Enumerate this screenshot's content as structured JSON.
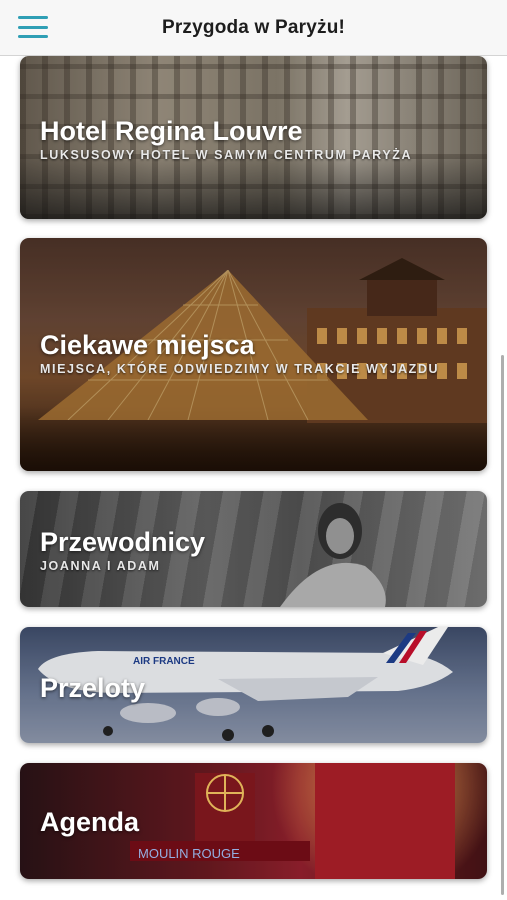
{
  "header": {
    "title": "Przygoda w Paryżu!",
    "menu_icon": "hamburger-menu-icon",
    "accent_color": "#2f9fb5"
  },
  "cards": [
    {
      "title": "Hotel Regina Louvre",
      "subtitle": "LUKSUSOWY HOTEL W SAMYM CENTRUM PARYŻA",
      "image": "hotel-facade-image"
    },
    {
      "title": "Ciekawe miejsca",
      "subtitle": "MIEJSCA, KTÓRE ODWIEDZIMY W TRAKCIE WYJAZDU",
      "image": "louvre-pyramid-image"
    },
    {
      "title": "Przewodnicy",
      "subtitle": "JOANNA I ADAM",
      "image": "guide-portrait-image"
    },
    {
      "title": "Przeloty",
      "subtitle": "",
      "image": "airplane-image",
      "airline_text": "AIR FRANCE"
    },
    {
      "title": "Agenda",
      "subtitle": "",
      "image": "moulin-rouge-image",
      "sign_text": "MOULIN ROUGE"
    }
  ]
}
